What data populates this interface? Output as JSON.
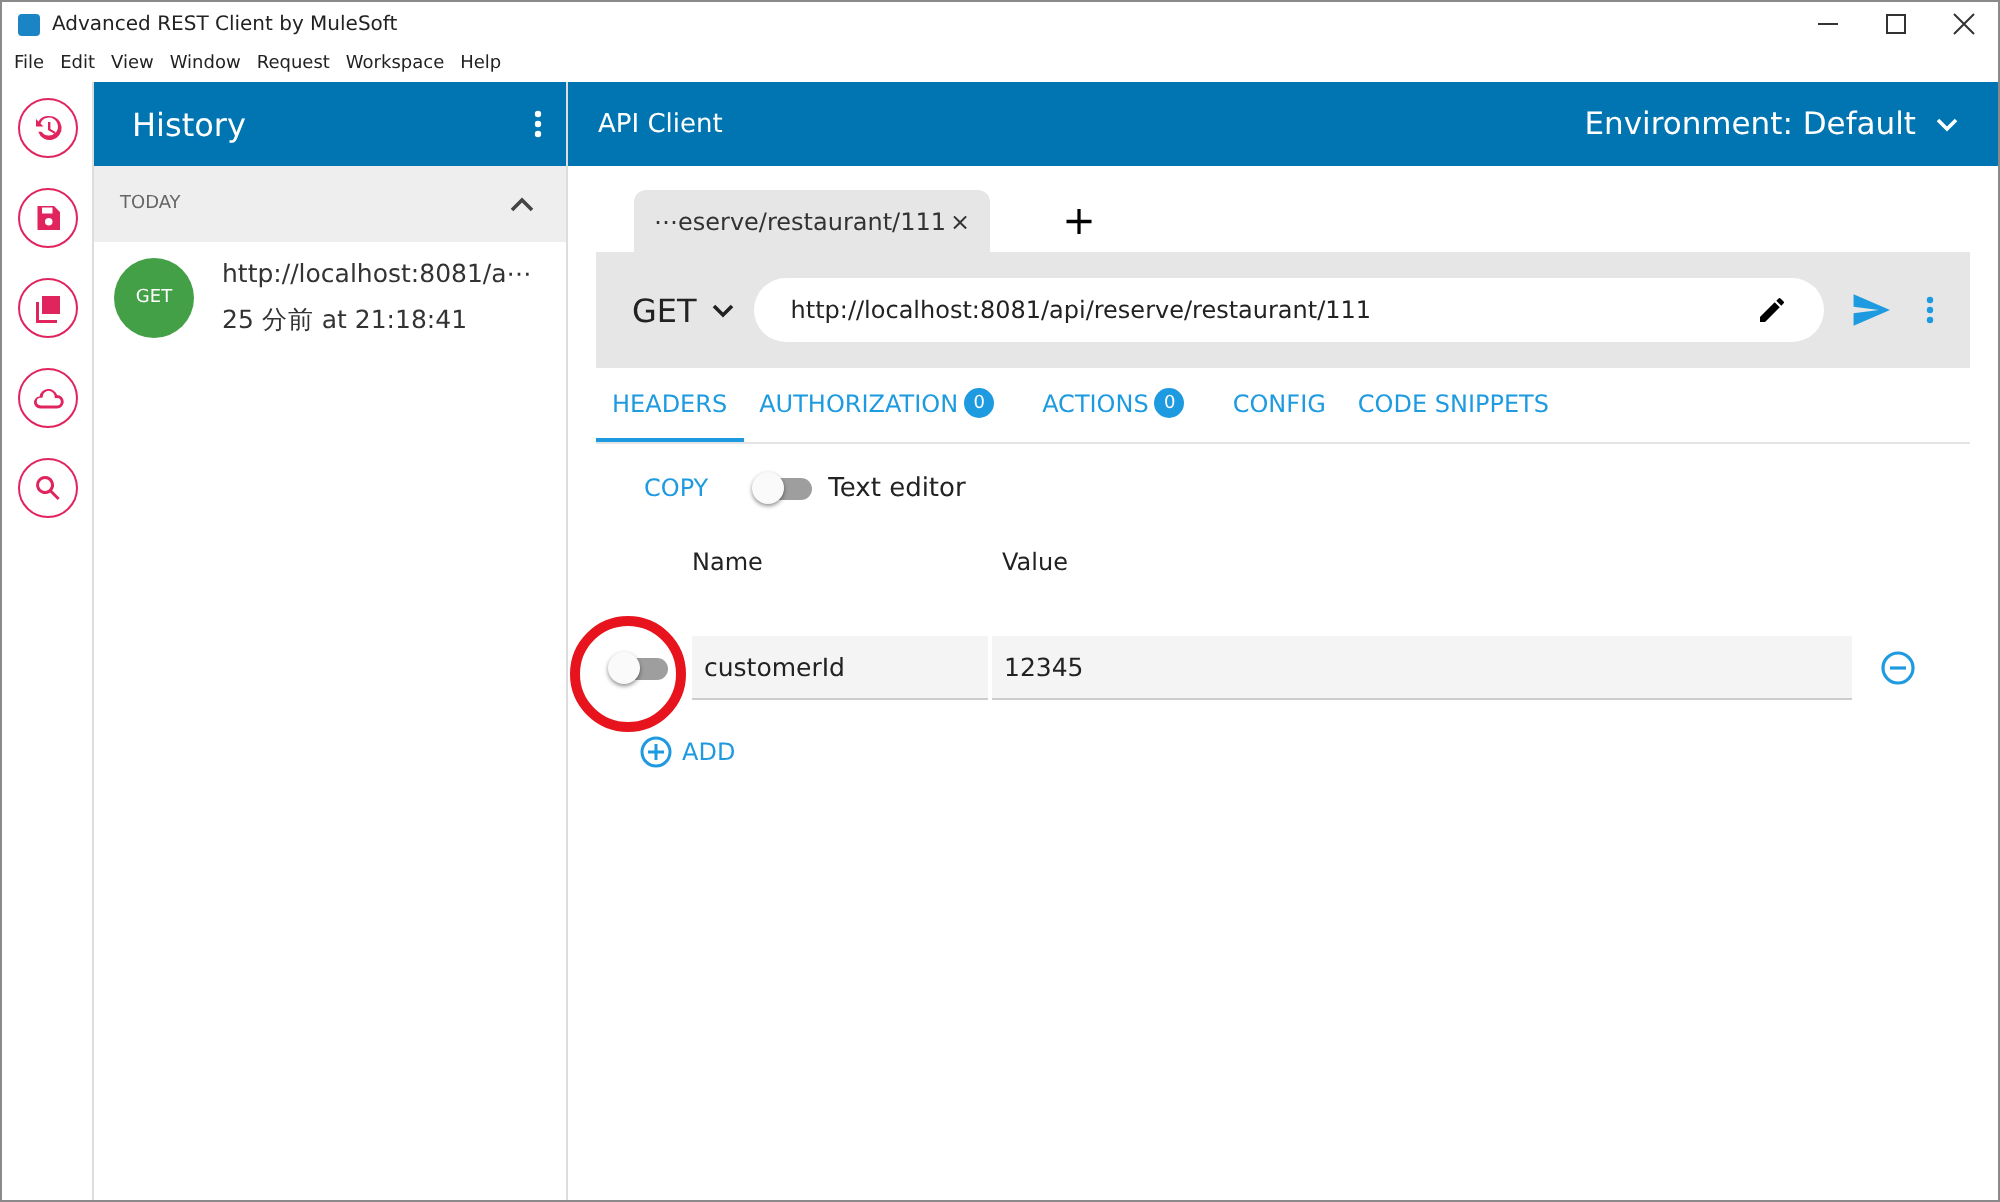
{
  "window": {
    "title": "Advanced REST Client by MuleSoft"
  },
  "menu": [
    "File",
    "Edit",
    "View",
    "Window",
    "Request",
    "Workspace",
    "Help"
  ],
  "history": {
    "title": "History",
    "section": {
      "label": "TODAY",
      "expanded": true
    },
    "items": [
      {
        "method": "GET",
        "url": "http://localhost:8081/a⋯",
        "time": "25 分前 at 21:18:41"
      }
    ]
  },
  "main": {
    "title": "API Client",
    "environment": "Environment: Default"
  },
  "request_tabs": [
    {
      "label": "⋯eserve/restaurant/111",
      "close": "×",
      "selected": true
    }
  ],
  "add_tab": "+",
  "request": {
    "method": "GET",
    "url": "http://localhost:8081/api/reserve/restaurant/111"
  },
  "editor_tabs": [
    {
      "label": "HEADERS",
      "selected": true
    },
    {
      "label": "AUTHORIZATION",
      "badge": "0",
      "selected": false
    },
    {
      "label": "ACTIONS",
      "badge": "0",
      "selected": false
    },
    {
      "label": "CONFIG",
      "selected": false
    },
    {
      "label": "CODE SNIPPETS",
      "selected": false
    }
  ],
  "copy": "COPY",
  "text_editor": {
    "label": "Text editor",
    "on": false
  },
  "columns": [
    "Name",
    "Value"
  ],
  "headers": [
    {
      "enabled": false,
      "name": "customerId",
      "value": "12345"
    }
  ],
  "add": "ADD"
}
